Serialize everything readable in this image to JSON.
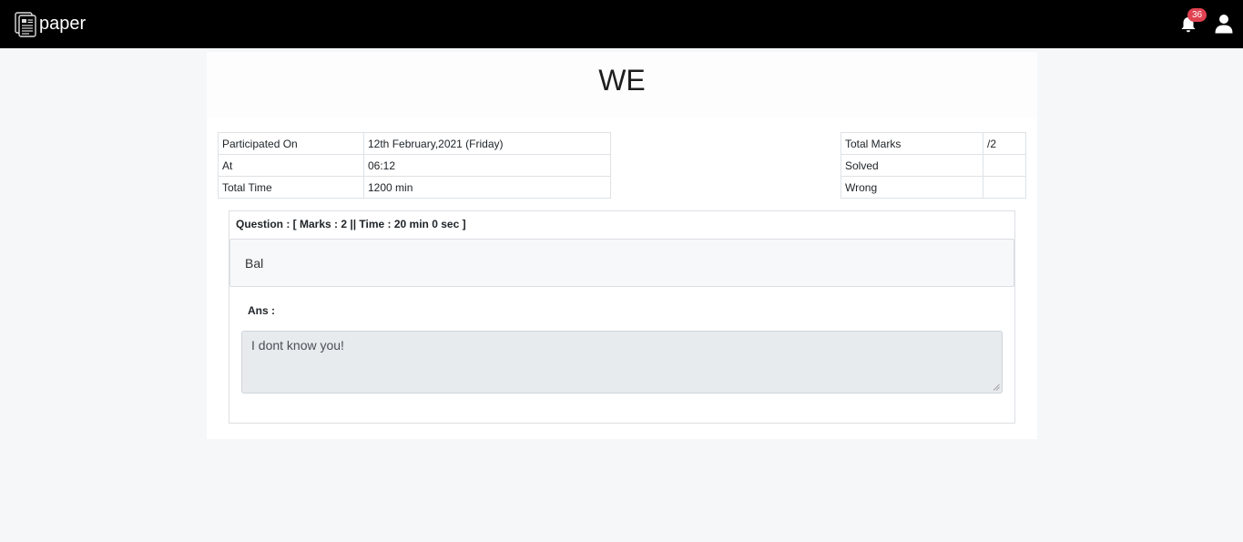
{
  "app": {
    "name": "paper"
  },
  "header": {
    "notifications_count": "36",
    "icons": {
      "logo": "newspaper-icon",
      "bell": "bell-icon",
      "user": "user-icon"
    }
  },
  "page": {
    "title": "WE"
  },
  "participation": [
    {
      "label": "Participated On",
      "value": "12th February,2021 (Friday)"
    },
    {
      "label": "At",
      "value": "06:12"
    },
    {
      "label": "Total Time",
      "value": "1200 min"
    }
  ],
  "marks": [
    {
      "label": "Total Marks",
      "value": "/2"
    },
    {
      "label": "Solved",
      "value": ""
    },
    {
      "label": "Wrong",
      "value": ""
    }
  ],
  "question": {
    "header": "Question : [ Marks : 2 || Time : 20 min 0 sec ]",
    "text": "Bal",
    "answer_label": "Ans :",
    "answer_value": "I dont know you!"
  },
  "colors": {
    "navbar": "#000000",
    "badge": "#e04150",
    "background": "#f6f7f9"
  }
}
